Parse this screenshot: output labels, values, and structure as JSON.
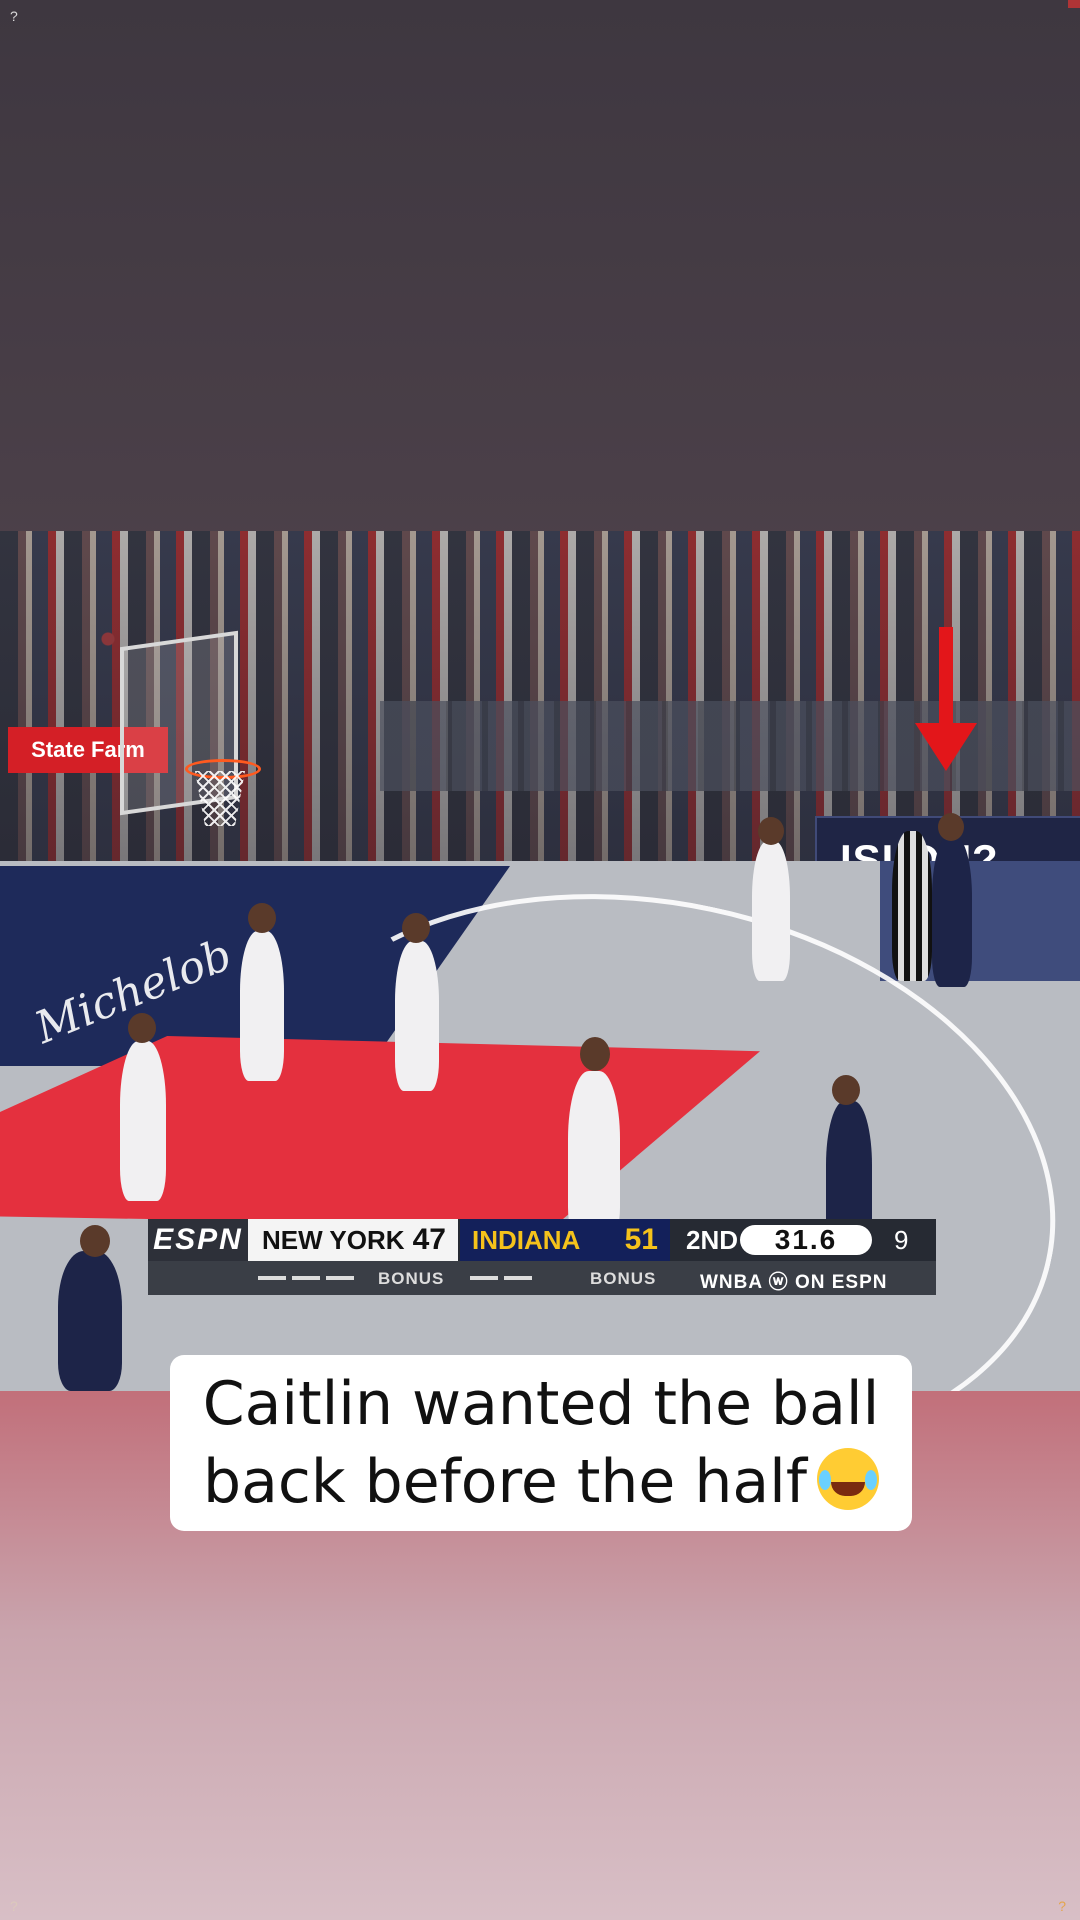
{
  "corners": {
    "top_left": "?",
    "bottom_left": "?",
    "bottom_right": "?"
  },
  "scene": {
    "sponsor_sign": "State Farm",
    "bench_sign": "ISI   OU?"
  },
  "scoreboard": {
    "network": "ESPN",
    "away_team": "NEW YORK",
    "away_score": "47",
    "home_team": "INDIANA",
    "home_score": "51",
    "period": "2ND",
    "clock": "31.6",
    "shot_clock": "9",
    "bonus_label_away": "BONUS",
    "bonus_label_home": "BONUS",
    "broadcast_tag": "WNBA ⓦ ON ESPN"
  },
  "caption": {
    "line1": "Caitlin wanted the ball",
    "line2": "back before the half",
    "emoji": "face-with-tears-of-joy"
  },
  "colors": {
    "arrow": "#e3161a",
    "indiana_gold": "#f5c21b",
    "indiana_navy": "#13205a"
  }
}
